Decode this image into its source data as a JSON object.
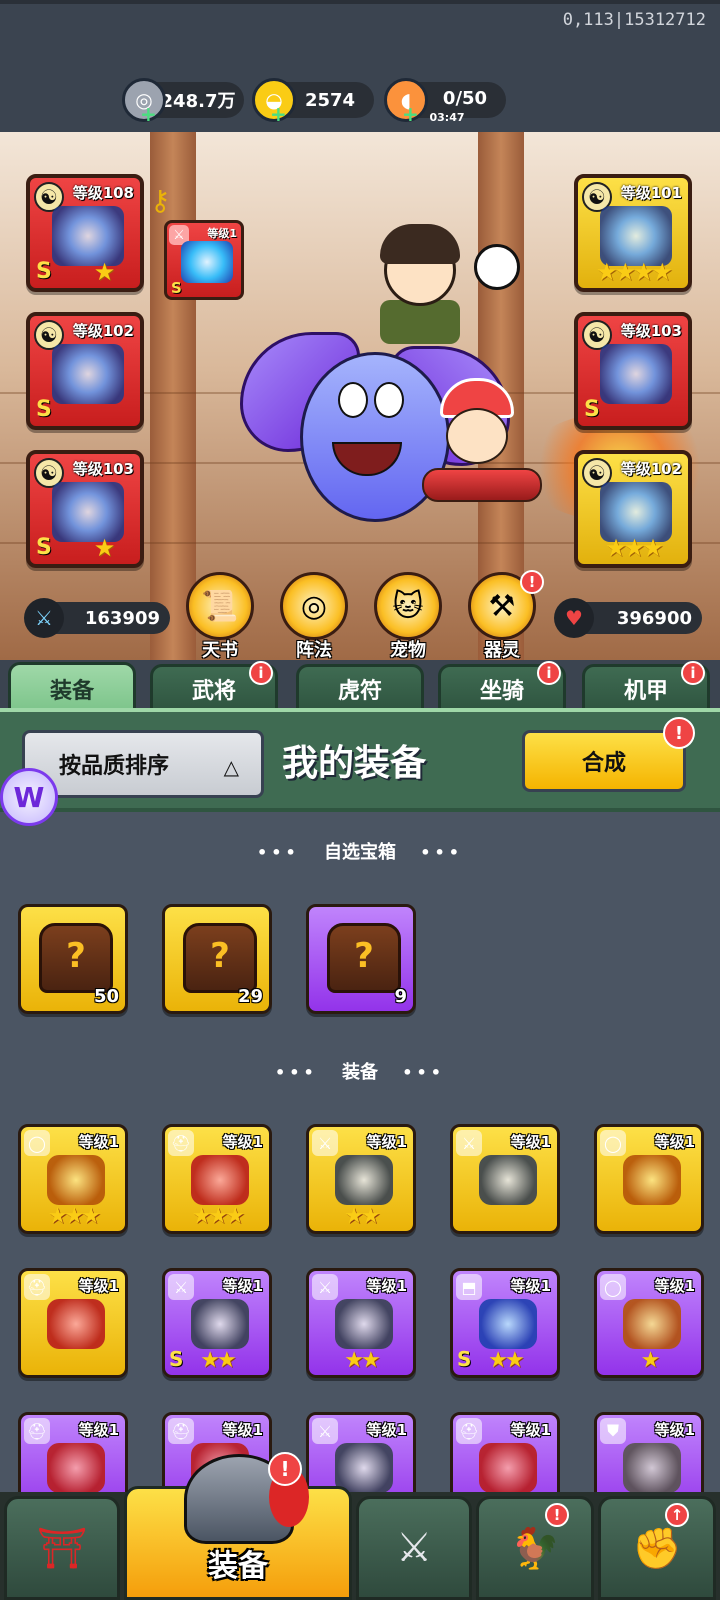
{
  "top": {
    "id_text": "0,113|15312712",
    "resources": [
      {
        "name": "silver",
        "icon": "silver-coin-icon",
        "value": "248.7万",
        "plus": "+"
      },
      {
        "name": "gold",
        "icon": "gold-ingot-icon",
        "value": "2574",
        "plus": "+"
      },
      {
        "name": "stamina",
        "icon": "drumstick-icon",
        "value": "0/50",
        "timer": "03:47",
        "plus": "+"
      }
    ]
  },
  "scene": {
    "slots": [
      {
        "level": "等级108",
        "grade": "S",
        "stars": "★",
        "color": "red"
      },
      {
        "level": "等级102",
        "grade": "S",
        "stars": "",
        "color": "red"
      },
      {
        "level": "等级103",
        "grade": "S",
        "stars": "★",
        "color": "red"
      },
      {
        "level": "等级101",
        "grade": "",
        "stars": "★★★★",
        "color": "gold"
      },
      {
        "level": "等级103",
        "grade": "S",
        "stars": "",
        "color": "red"
      },
      {
        "level": "等级102",
        "grade": "",
        "stars": "★★★",
        "color": "gold"
      }
    ],
    "small_weapon": {
      "level": "等级1",
      "grade": "S"
    },
    "attack": "163909",
    "hp": "396900",
    "functions": [
      {
        "label": "天书",
        "icon": "scroll-icon",
        "badge": ""
      },
      {
        "label": "阵法",
        "icon": "formation-icon",
        "badge": ""
      },
      {
        "label": "宠物",
        "icon": "pet-cat-icon",
        "badge": ""
      },
      {
        "label": "器灵",
        "icon": "spirit-icon",
        "badge": "!"
      }
    ]
  },
  "tabs": [
    {
      "label": "装备",
      "active": true,
      "badge": ""
    },
    {
      "label": "武将",
      "active": false,
      "badge": "i"
    },
    {
      "label": "虎符",
      "active": false,
      "badge": ""
    },
    {
      "label": "坐骑",
      "active": false,
      "badge": "i"
    },
    {
      "label": "机甲",
      "active": false,
      "badge": "i"
    }
  ],
  "panel": {
    "sort_label": "按品质排序",
    "sort_arrow": "△",
    "title": "我的装备",
    "merge_label": "合成",
    "merge_badge": "!",
    "logo_letter": "W"
  },
  "sections": {
    "chests_title": "自选宝箱",
    "equipment_title": "装备",
    "dots_left": "•••",
    "dots_right": "•••"
  },
  "chests": [
    {
      "count": "50",
      "color": "gold"
    },
    {
      "count": "29",
      "color": "gold"
    },
    {
      "count": "9",
      "color": "purple"
    }
  ],
  "items": [
    {
      "level": "等级1",
      "stars": "★★★",
      "grade": "",
      "color": "gold",
      "slot": "necklace"
    },
    {
      "level": "等级1",
      "stars": "★★★",
      "grade": "",
      "color": "gold",
      "slot": "helmet"
    },
    {
      "level": "等级1",
      "stars": "★★",
      "grade": "",
      "color": "gold",
      "slot": "weapon"
    },
    {
      "level": "等级1",
      "stars": "",
      "grade": "",
      "color": "gold",
      "slot": "weapon"
    },
    {
      "level": "等级1",
      "stars": "",
      "grade": "",
      "color": "gold",
      "slot": "necklace"
    },
    {
      "level": "等级1",
      "stars": "",
      "grade": "",
      "color": "gold",
      "slot": "helmet"
    },
    {
      "level": "等级1",
      "stars": "★★",
      "grade": "S",
      "color": "purple",
      "slot": "weapon"
    },
    {
      "level": "等级1",
      "stars": "★★",
      "grade": "",
      "color": "purple",
      "slot": "weapon"
    },
    {
      "level": "等级1",
      "stars": "★★",
      "grade": "S",
      "color": "purple",
      "slot": "boots"
    },
    {
      "level": "等级1",
      "stars": "★",
      "grade": "",
      "color": "purple",
      "slot": "necklace"
    },
    {
      "level": "等级1",
      "stars": "",
      "grade": "",
      "color": "purple",
      "slot": "helmet"
    },
    {
      "level": "等级1",
      "stars": "",
      "grade": "",
      "color": "purple",
      "slot": "helmet"
    },
    {
      "level": "等级1",
      "stars": "",
      "grade": "",
      "color": "purple",
      "slot": "weapon"
    },
    {
      "level": "等级1",
      "stars": "",
      "grade": "",
      "color": "purple",
      "slot": "helmet"
    },
    {
      "level": "等级1",
      "stars": "",
      "grade": "",
      "color": "purple",
      "slot": "armor"
    }
  ],
  "bottom_nav": [
    {
      "name": "shop",
      "icon": "gate-coin-icon",
      "label": "",
      "badge": ""
    },
    {
      "name": "equipment",
      "icon": "helmet-icon",
      "label": "装备",
      "badge": "!"
    },
    {
      "name": "battle",
      "icon": "crossed-swords-icon",
      "label": "",
      "badge": ""
    },
    {
      "name": "pet",
      "icon": "rooster-icon",
      "label": "",
      "badge": "!"
    },
    {
      "name": "upgrade",
      "icon": "fist-upgrade-icon",
      "label": "",
      "badge": "↑"
    }
  ]
}
